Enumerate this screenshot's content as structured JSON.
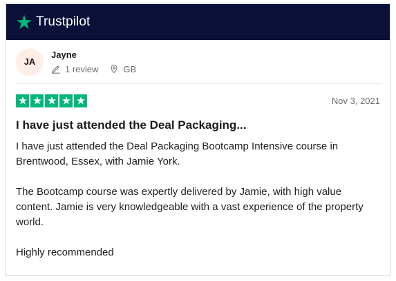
{
  "brand": {
    "name": "Trustpilot",
    "header_color": "#0b1038",
    "star_color": "#00b67a"
  },
  "reviewer": {
    "initials": "JA",
    "name": "Jayne",
    "review_count": "1 review",
    "country": "GB",
    "review_icon": "pencil-icon",
    "location_icon": "location-pin-icon"
  },
  "review": {
    "rating": 5,
    "date": "Nov 3, 2021",
    "title": "I have just attended the Deal Packaging...",
    "paragraphs": [
      "I have just attended the Deal Packaging Bootcamp Intensive course in Brentwood, Essex, with Jamie York.",
      "The Bootcamp course was expertly delivered by Jamie, with high value content. Jamie is very knowledgeable with a vast experience of the property world.",
      "Highly recommended"
    ]
  }
}
